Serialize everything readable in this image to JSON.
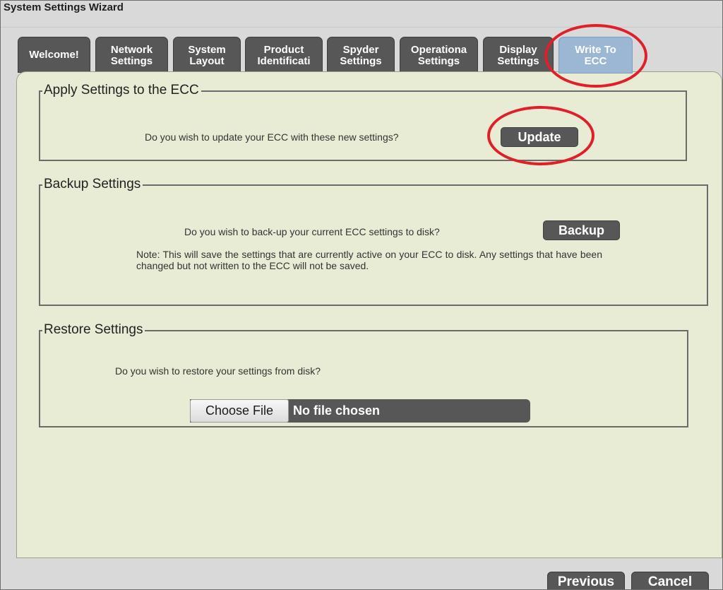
{
  "window": {
    "title": "System Settings Wizard"
  },
  "tabs": [
    {
      "line1": "Welcome!",
      "line2": ""
    },
    {
      "line1": "Network",
      "line2": "Settings"
    },
    {
      "line1": "System",
      "line2": "Layout"
    },
    {
      "line1": "Product",
      "line2": "Identificati"
    },
    {
      "line1": "Spyder",
      "line2": "Settings"
    },
    {
      "line1": "Operationa",
      "line2": "Settings"
    },
    {
      "line1": "Display",
      "line2": "Settings"
    },
    {
      "line1": "Write To",
      "line2": "ECC",
      "active": true
    }
  ],
  "apply": {
    "legend": "Apply Settings to the ECC",
    "prompt": "Do you wish to update your ECC with these new settings?",
    "button": "Update"
  },
  "backup": {
    "legend": "Backup Settings",
    "prompt": "Do you wish to back-up your current ECC settings to disk?",
    "button": "Backup",
    "note": "Note: This will save the settings that are currently active on your ECC to disk. Any settings that have been changed but not written to the ECC will not be saved."
  },
  "restore": {
    "legend": "Restore Settings",
    "prompt": "Do you wish to restore your settings from disk?",
    "choose_label": "Choose File",
    "file_status": "No file chosen"
  },
  "footer": {
    "previous": "Previous",
    "cancel": "Cancel"
  },
  "colors": {
    "panel_bg": "#e8ecd5",
    "tab_bg": "#575757",
    "active_tab_bg": "#9cb7d3",
    "highlight_ring": "#e01f2a"
  }
}
